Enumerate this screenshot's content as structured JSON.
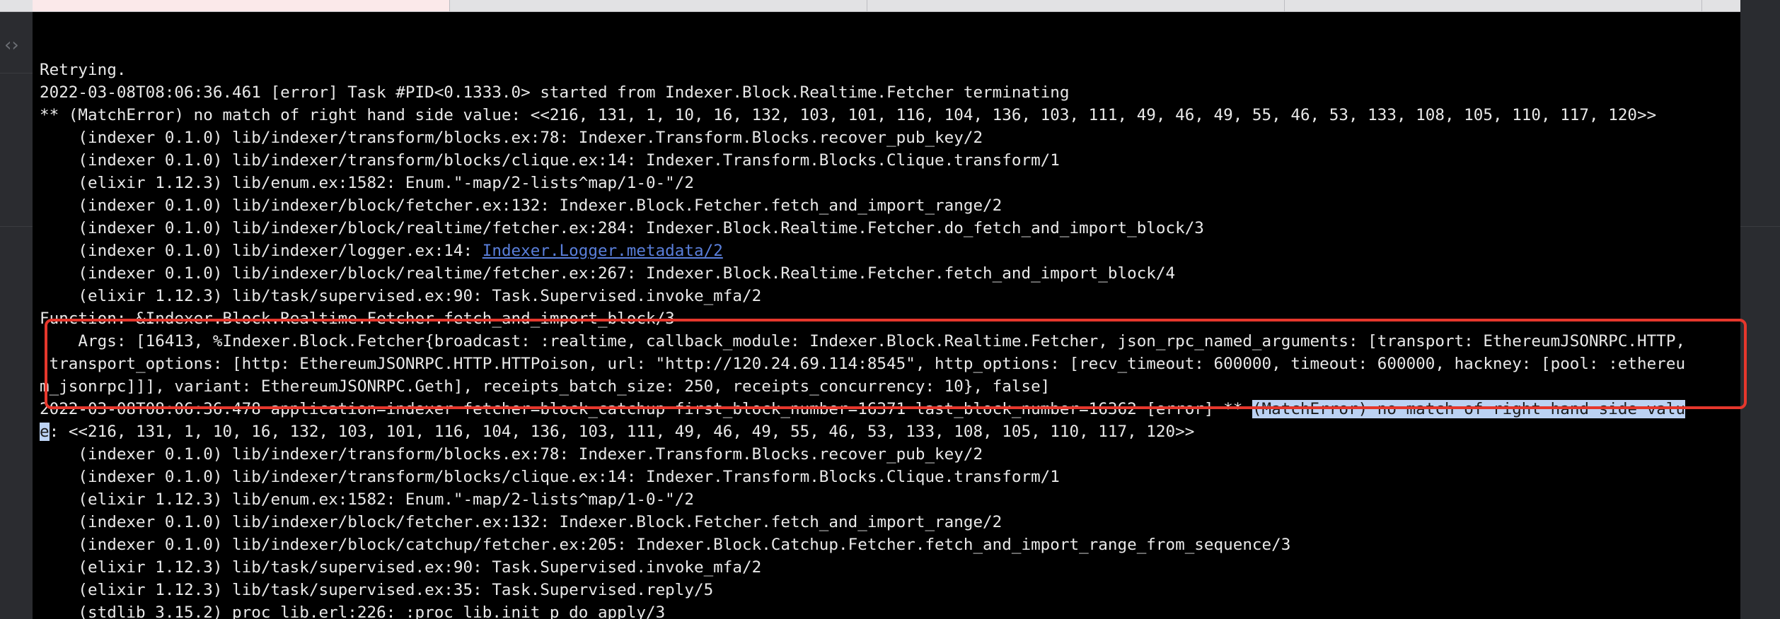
{
  "terminal": {
    "lines": [
      {
        "text": "Retrying."
      },
      {
        "text": "2022-03-08T08:06:36.461 [error] Task #PID<0.1333.0> started from Indexer.Block.Realtime.Fetcher terminating"
      },
      {
        "text": "** (MatchError) no match of right hand side value: <<216, 131, 1, 10, 16, 132, 103, 101, 116, 104, 136, 103, 111, 49, 46, 49, 55, 46, 53, 133, 108, 105, 110, 117, 120>>"
      },
      {
        "text": "    (indexer 0.1.0) lib/indexer/transform/blocks.ex:78: Indexer.Transform.Blocks.recover_pub_key/2"
      },
      {
        "text": "    (indexer 0.1.0) lib/indexer/transform/blocks/clique.ex:14: Indexer.Transform.Blocks.Clique.transform/1"
      },
      {
        "text": "    (elixir 1.12.3) lib/enum.ex:1582: Enum.\"-map/2-lists^map/1-0-\"/2"
      },
      {
        "text": "    (indexer 0.1.0) lib/indexer/block/fetcher.ex:132: Indexer.Block.Fetcher.fetch_and_import_range/2"
      },
      {
        "text": "    (indexer 0.1.0) lib/indexer/block/realtime/fetcher.ex:284: Indexer.Block.Realtime.Fetcher.do_fetch_and_import_block/3"
      },
      {
        "prefix": "    (indexer 0.1.0) lib/indexer/logger.ex:14: ",
        "link": "Indexer.Logger.metadata/2"
      },
      {
        "text": "    (indexer 0.1.0) lib/indexer/block/realtime/fetcher.ex:267: Indexer.Block.Realtime.Fetcher.fetch_and_import_block/4"
      },
      {
        "text": "    (elixir 1.12.3) lib/task/supervised.ex:90: Task.Supervised.invoke_mfa/2"
      },
      {
        "text": "Function: &Indexer.Block.Realtime.Fetcher.fetch_and_import_block/3"
      },
      {
        "text": "    Args: [16413, %Indexer.Block.Fetcher{broadcast: :realtime, callback_module: Indexer.Block.Realtime.Fetcher, json_rpc_named_arguments: [transport: EthereumJSONRPC.HTTP,"
      },
      {
        "text": " transport_options: [http: EthereumJSONRPC.HTTP.HTTPoison, url: \"http://120.24.69.114:8545\", http_options: [recv_timeout: 600000, timeout: 600000, hackney: [pool: :ethereu"
      },
      {
        "text": "m_jsonrpc]]], variant: EthereumJSONRPC.Geth], receipts_batch_size: 250, receipts_concurrency: 10}, false]"
      },
      {
        "prefix": "2022-03-08T08:06:36.478 application=indexer fetcher=block_catchup first_block_number=16371 last_block_number=16362 [error] ** ",
        "selected": "(MatchError) no match of right hand side valu"
      },
      {
        "selected": "e",
        "suffix": ": <<216, 131, 1, 10, 16, 132, 103, 101, 116, 104, 136, 103, 111, 49, 46, 49, 55, 46, 53, 133, 108, 105, 110, 117, 120>>"
      },
      {
        "text": "    (indexer 0.1.0) lib/indexer/transform/blocks.ex:78: Indexer.Transform.Blocks.recover_pub_key/2"
      },
      {
        "text": "    (indexer 0.1.0) lib/indexer/transform/blocks/clique.ex:14: Indexer.Transform.Blocks.Clique.transform/1"
      },
      {
        "text": "    (elixir 1.12.3) lib/enum.ex:1582: Enum.\"-map/2-lists^map/1-0-\"/2"
      },
      {
        "text": "    (indexer 0.1.0) lib/indexer/block/fetcher.ex:132: Indexer.Block.Fetcher.fetch_and_import_range/2"
      },
      {
        "text": "    (indexer 0.1.0) lib/indexer/block/catchup/fetcher.ex:205: Indexer.Block.Catchup.Fetcher.fetch_and_import_range_from_sequence/3"
      },
      {
        "text": "    (elixir 1.12.3) lib/task/supervised.ex:90: Task.Supervised.invoke_mfa/2"
      },
      {
        "text": "    (elixir 1.12.3) lib/task/supervised.ex:35: Task.Supervised.reply/5"
      },
      {
        "text": "    (stdlib 3.15.2) proc_lib.erl:226: :proc_lib.init_p_do_apply/3"
      }
    ]
  },
  "colors": {
    "background": "#000000",
    "text": "#e9e9e9",
    "link": "#5a7fdb",
    "selection": "#bcd2f3",
    "annotation": "#e5372c"
  },
  "icons": {
    "gutter": "code-brackets-icon"
  }
}
